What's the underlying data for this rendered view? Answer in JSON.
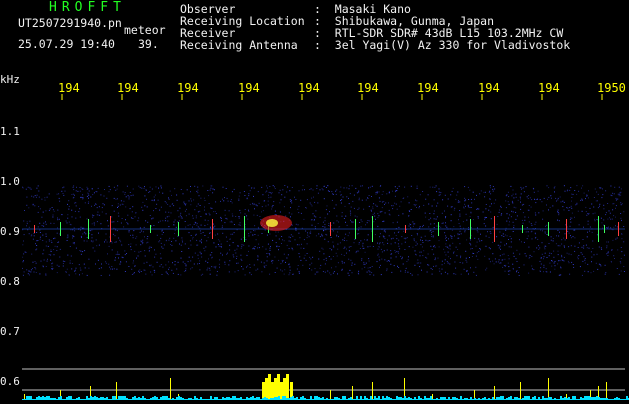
{
  "header": {
    "logo": "HROFFT",
    "filename": "UT2507291940.pn",
    "mode": "meteor",
    "datetime": "25.07.29 19:40",
    "count": "39.",
    "fields": [
      {
        "label": "Observer",
        "value": ":  Masaki Kano"
      },
      {
        "label": "Receiving Location",
        "value": ":  Shibukawa, Gunma, Japan"
      },
      {
        "label": "Receiver",
        "value": ":  RTL-SDR SDR# 43dB L15 103.2MHz CW"
      },
      {
        "label": "Receiving Antenna",
        "value": ":  3el Yagi(V) Az 330 for Vladivostok"
      }
    ]
  },
  "spectrogram": {
    "unit": "kHz",
    "frequency_ticks": [
      "1.1",
      "1.0",
      "0.9",
      "0.8",
      "0.7",
      "0.6"
    ],
    "time_ticks": [
      "194",
      "194",
      "194",
      "194",
      "194",
      "194",
      "194",
      "194",
      "194",
      "1950"
    ],
    "colors": {
      "background": "#000000",
      "noise": "#1a3aa8",
      "signal": "#ff2020",
      "histogram": "#ffff00",
      "baseline": "#00e0ff"
    }
  }
}
